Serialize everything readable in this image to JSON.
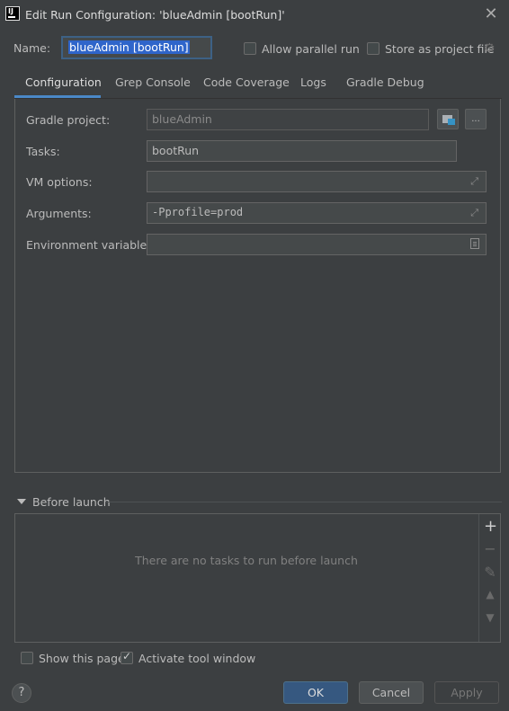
{
  "window": {
    "title": "Edit Run Configuration: 'blueAdmin [bootRun]'",
    "icon": "intellij-icon",
    "close": "✕"
  },
  "name_row": {
    "label": "Name:",
    "value": "blueAdmin [bootRun]",
    "allow_parallel_label": "Allow parallel run",
    "allow_parallel_checked": false,
    "store_label": "Store as project file",
    "store_checked": false
  },
  "tabs": [
    {
      "label": "Configuration",
      "active": true
    },
    {
      "label": "Grep Console",
      "active": false
    },
    {
      "label": "Code Coverage",
      "active": false
    },
    {
      "label": "Logs",
      "active": false
    },
    {
      "label": "Gradle Debug",
      "active": false
    }
  ],
  "config": {
    "gradle_project_label": "Gradle project:",
    "gradle_project_value": "blueAdmin",
    "more_button": "...",
    "tasks_label": "Tasks:",
    "tasks_value": "bootRun",
    "vm_options_label": "VM options:",
    "vm_options_value": "",
    "arguments_label": "Arguments:",
    "arguments_value": "-Pprofile=prod",
    "env_label": "Environment variables:",
    "env_value": ""
  },
  "before_launch": {
    "title": "Before launch",
    "empty_text": "There are no tasks to run before launch"
  },
  "footer": {
    "show_page_label": "Show this page",
    "show_page_checked": false,
    "activate_label": "Activate tool window",
    "activate_checked": true,
    "help": "?",
    "ok": "OK",
    "cancel": "Cancel",
    "apply": "Apply"
  },
  "colors": {
    "background": "#3c3f41",
    "accent": "#4a88c7",
    "primary_button": "#365880",
    "selection": "#2f65ca"
  }
}
